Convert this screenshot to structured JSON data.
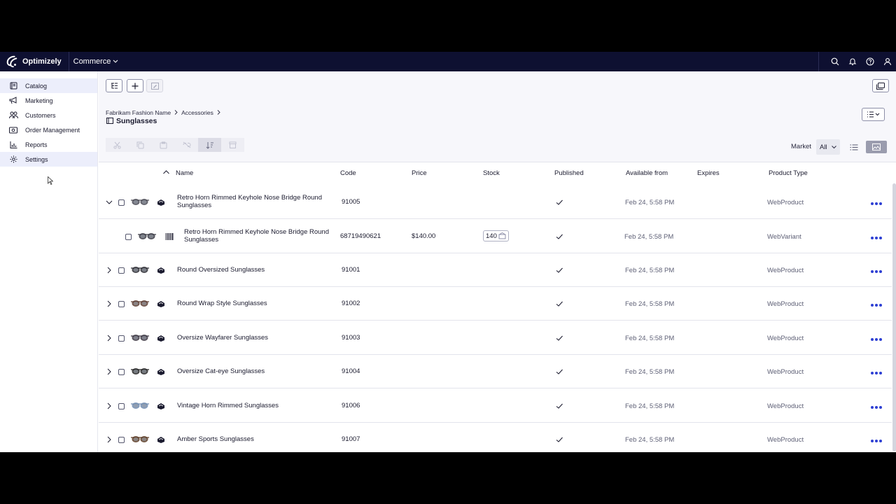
{
  "topbar": {
    "brand": "Optimizely",
    "app": "Commerce",
    "icons": [
      "search-icon",
      "bell-icon",
      "help-icon",
      "user-icon"
    ]
  },
  "sidebar": {
    "items": [
      {
        "label": "Catalog",
        "icon": "book-icon"
      },
      {
        "label": "Marketing",
        "icon": "megaphone-icon"
      },
      {
        "label": "Customers",
        "icon": "people-icon"
      },
      {
        "label": "Order Management",
        "icon": "cash-icon"
      },
      {
        "label": "Reports",
        "icon": "bar-chart-icon"
      },
      {
        "label": "Settings",
        "icon": "gear-icon"
      }
    ]
  },
  "breadcrumb": [
    "Fabrikam Fashion Name",
    "Accessories"
  ],
  "page_title": "Sunglasses",
  "market": {
    "label": "Market",
    "value": "All"
  },
  "table": {
    "columns": [
      "Name",
      "Code",
      "Price",
      "Stock",
      "Published",
      "Available from",
      "Expires",
      "Product Type"
    ],
    "rows": [
      {
        "expanded": true,
        "name": "Retro Horn Rimmed Keyhole Nose Bridge Round Sunglasses",
        "code": "91005",
        "price": "",
        "stock": "",
        "available": "Feb 24, 5:58 PM",
        "expires": "",
        "type": "WebProduct",
        "kind": "product"
      },
      {
        "expanded": false,
        "name": "Retro Horn Rimmed Keyhole Nose Bridge Round Sunglasses",
        "code": "68719490621",
        "price": "$140.00",
        "stock": "140",
        "available": "Feb 24, 5:58 PM",
        "expires": "",
        "type": "WebVariant",
        "kind": "variant"
      },
      {
        "expanded": false,
        "name": "Round Oversized Sunglasses",
        "code": "91001",
        "price": "",
        "stock": "",
        "available": "Feb 24, 5:58 PM",
        "expires": "",
        "type": "WebProduct",
        "kind": "product"
      },
      {
        "expanded": false,
        "name": "Round Wrap Style Sunglasses",
        "code": "91002",
        "price": "",
        "stock": "",
        "available": "Feb 24, 5:58 PM",
        "expires": "",
        "type": "WebProduct",
        "kind": "product"
      },
      {
        "expanded": false,
        "name": "Oversize Wayfarer Sunglasses",
        "code": "91003",
        "price": "",
        "stock": "",
        "available": "Feb 24, 5:58 PM",
        "expires": "",
        "type": "WebProduct",
        "kind": "product"
      },
      {
        "expanded": false,
        "name": "Oversize Cat-eye Sunglasses",
        "code": "91004",
        "price": "",
        "stock": "",
        "available": "Feb 24, 5:58 PM",
        "expires": "",
        "type": "WebProduct",
        "kind": "product"
      },
      {
        "expanded": false,
        "name": "Vintage Horn Rimmed Sunglasses",
        "code": "91006",
        "price": "",
        "stock": "",
        "available": "Feb 24, 5:58 PM",
        "expires": "",
        "type": "WebProduct",
        "kind": "product"
      },
      {
        "expanded": false,
        "name": "Amber Sports Sunglasses",
        "code": "91007",
        "price": "",
        "stock": "",
        "available": "Feb 24, 5:58 PM",
        "expires": "",
        "type": "WebProduct",
        "kind": "product"
      }
    ]
  },
  "colors": {
    "topbar": "#0e1031",
    "accent": "#2d3fd3",
    "sidebar_active": "#eceefb"
  }
}
